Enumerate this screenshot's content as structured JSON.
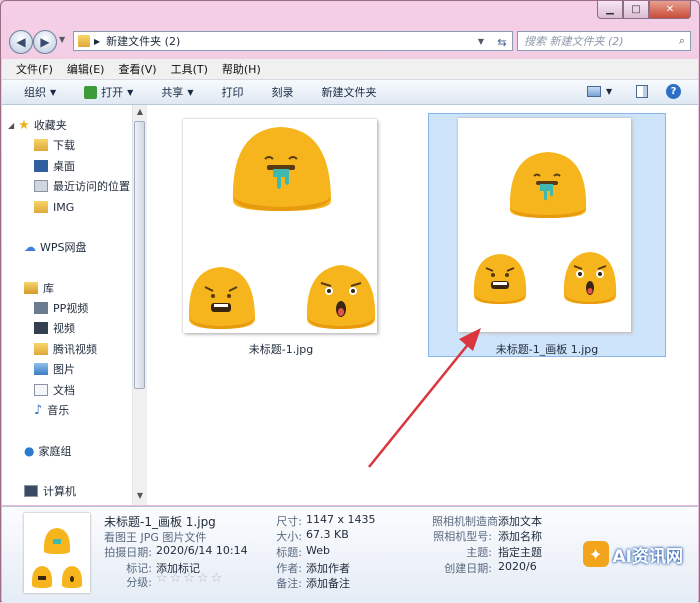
{
  "window": {
    "minimize": "▁",
    "maximize": "□",
    "close": "✕"
  },
  "address": {
    "path": "新建文件夹 (2)",
    "search_placeholder": "搜索 新建文件夹 (2)"
  },
  "menu": [
    "文件(F)",
    "编辑(E)",
    "查看(V)",
    "工具(T)",
    "帮助(H)"
  ],
  "toolbar": {
    "organize": "组织",
    "open": "打开",
    "share": "共享",
    "print": "打印",
    "burn": "刻录",
    "new_folder": "新建文件夹"
  },
  "nav": {
    "favorites": "收藏夹",
    "downloads": "下载",
    "desktop": "桌面",
    "recent": "最近访问的位置",
    "img": "IMG",
    "wps": "WPS网盘",
    "library": "库",
    "pp_video": "PP视频",
    "video": "视频",
    "tencent_video": "腾讯视频",
    "pictures": "图片",
    "documents": "文档",
    "music": "音乐",
    "homegroup": "家庭组",
    "computer": "计算机"
  },
  "files": [
    {
      "name": "未标题-1.jpg",
      "selected": false
    },
    {
      "name": "未标题-1_画板 1.jpg",
      "selected": true
    }
  ],
  "details": {
    "filename": "未标题-1_画板 1.jpg",
    "filetype": "看图王 JPG 图片文件",
    "date_label": "拍摄日期:",
    "date_value": "2020/6/14 10:14",
    "tags_label": "标记:",
    "tags_value": "添加标记",
    "rating_label": "分级:",
    "rating_stars": "☆☆☆☆☆",
    "dims_label": "尺寸:",
    "dims_value": "1147 x 1435",
    "size_label": "大小:",
    "size_value": "67.3 KB",
    "title_label": "标题:",
    "title_value": "Web",
    "author_label": "作者:",
    "author_value": "添加作者",
    "note_label": "备注:",
    "note_value": "添加备注",
    "maker_label": "照相机制造商:",
    "maker_value": "添加文本",
    "model_label": "照相机型号:",
    "model_value": "添加名称",
    "subject_label": "主题:",
    "subject_value": "指定主题",
    "created_label": "创建日期:",
    "created_value": "2020/6"
  },
  "watermark": {
    "badge": "✦",
    "text": "AI资讯网"
  },
  "colors": {
    "emoji": "#f6b51c",
    "emoji_shadow": "#e89a0f",
    "arrow": "#d9363e",
    "selection": "#cde4fb"
  }
}
